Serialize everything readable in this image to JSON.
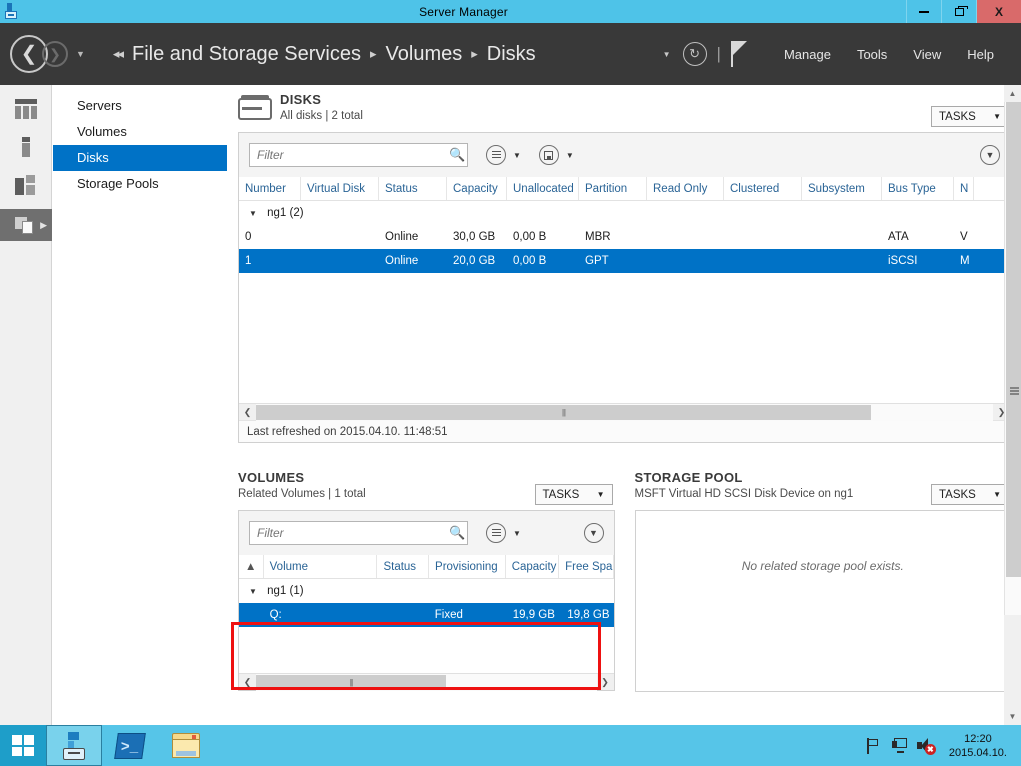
{
  "window": {
    "title": "Server Manager",
    "icon": "server-manager-icon",
    "controls": {
      "minimize": "minimize",
      "maximize": "maximize",
      "close": "X"
    }
  },
  "nav": {
    "back_icon": "back-arrow-icon",
    "forward_icon": "forward-arrow-icon",
    "dropdown_caret": "chevron-down-icon",
    "breadcrumb_prefix": "◂◂",
    "breadcrumbs": [
      {
        "label": "File and Storage Services"
      },
      {
        "label": "Volumes"
      },
      {
        "label": "Disks"
      }
    ],
    "separator": "▸",
    "refresh_icon": "refresh-icon",
    "notifications_icon": "flag-icon",
    "menu": [
      {
        "label": "Manage"
      },
      {
        "label": "Tools"
      },
      {
        "label": "View"
      },
      {
        "label": "Help"
      }
    ]
  },
  "rail": {
    "items": [
      {
        "name": "dashboard",
        "icon": "dashboard-icon",
        "active": false
      },
      {
        "name": "local-server",
        "icon": "server-icon",
        "active": false
      },
      {
        "name": "all-servers",
        "icon": "server-group-icon",
        "active": false
      },
      {
        "name": "file-and-storage-services",
        "icon": "file-storage-icon",
        "active": true
      }
    ]
  },
  "sidebar": {
    "items": [
      {
        "label": "Servers",
        "selected": false
      },
      {
        "label": "Volumes",
        "selected": false
      },
      {
        "label": "Disks",
        "selected": true
      },
      {
        "label": "Storage Pools",
        "selected": false
      }
    ]
  },
  "disks_panel": {
    "title": "DISKS",
    "subtitle": "All disks | 2 total",
    "tasks_label": "TASKS",
    "filter_placeholder": "Filter",
    "search_icon": "search-icon",
    "view_icon": "list-view-icon",
    "save_icon": "save-query-icon",
    "collapse_icon": "chevron-down-icon",
    "columns": [
      "Number",
      "Virtual Disk",
      "Status",
      "Capacity",
      "Unallocated",
      "Partition",
      "Read Only",
      "Clustered",
      "Subsystem",
      "Bus Type",
      "N"
    ],
    "group_label": "ng1 (2)",
    "rows": [
      {
        "number": "0",
        "virtual_disk": "",
        "status": "Online",
        "capacity": "30,0 GB",
        "unallocated": "0,00 B",
        "partition": "MBR",
        "read_only": "",
        "clustered": "",
        "subsystem": "",
        "bus_type": "ATA",
        "name": "V",
        "selected": false
      },
      {
        "number": "1",
        "virtual_disk": "",
        "status": "Online",
        "capacity": "20,0 GB",
        "unallocated": "0,00 B",
        "partition": "GPT",
        "read_only": "",
        "clustered": "",
        "subsystem": "",
        "bus_type": "iSCSI",
        "name": "M",
        "selected": true
      }
    ],
    "status_text": "Last refreshed on 2015.04.10. 11:48:51"
  },
  "volumes_panel": {
    "title": "VOLUMES",
    "subtitle": "Related Volumes | 1 total",
    "tasks_label": "TASKS",
    "filter_placeholder": "Filter",
    "search_icon": "search-icon",
    "view_icon": "list-view-icon",
    "collapse_icon": "chevron-down-icon",
    "warning_icon": "warning-icon",
    "sort_icon": "sort-ascending-icon",
    "columns": [
      "Volume",
      "Status",
      "Provisioning",
      "Capacity",
      "Free Spa"
    ],
    "group_label": "ng1 (1)",
    "rows": [
      {
        "volume": "Q:",
        "status": "",
        "provisioning": "Fixed",
        "capacity": "19,9 GB",
        "free_space": "19,8 GB",
        "selected": true
      }
    ]
  },
  "storage_pool_panel": {
    "title": "STORAGE POOL",
    "subtitle": "MSFT Virtual HD SCSI Disk Device on ng1",
    "tasks_label": "TASKS",
    "empty_message": "No related storage pool exists."
  },
  "taskbar": {
    "start_icon": "windows-start-icon",
    "items": [
      {
        "name": "server-manager",
        "icon": "server-manager-icon",
        "active": true
      },
      {
        "name": "powershell",
        "icon": "powershell-icon",
        "active": false
      },
      {
        "name": "file-explorer",
        "icon": "file-explorer-icon",
        "active": false
      }
    ],
    "tray": [
      {
        "name": "action-center",
        "icon": "flag-icon"
      },
      {
        "name": "network",
        "icon": "network-icon"
      },
      {
        "name": "volume-muted",
        "icon": "volume-muted-icon"
      }
    ],
    "clock_time": "12:20",
    "clock_date": "2015.04.10."
  },
  "colors": {
    "titlebar": "#4ec3e8",
    "navbar": "#393939",
    "accent_selection": "#0072c6",
    "highlight_box": "#ee1111",
    "taskbar": "#56c5e8",
    "column_header_text": "#2a6496"
  }
}
